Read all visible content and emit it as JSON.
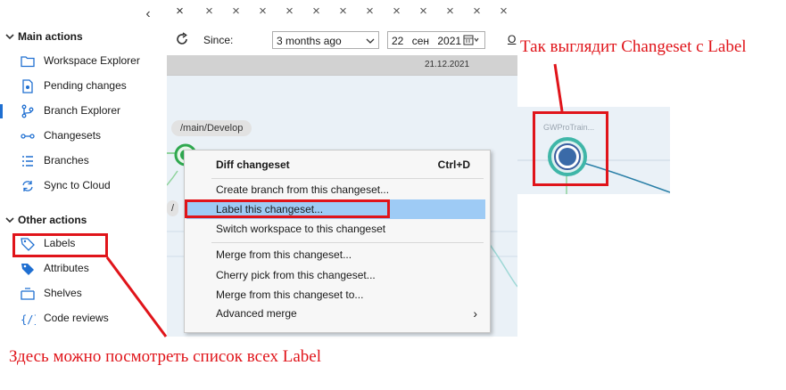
{
  "sidebar": {
    "collapse_glyph": "‹",
    "main_header": "Main actions",
    "main_items": [
      {
        "label": "Workspace Explorer",
        "icon": "folder-icon"
      },
      {
        "label": "Pending changes",
        "icon": "pending-changes-icon"
      },
      {
        "label": "Branch Explorer",
        "icon": "branch-explorer-icon"
      },
      {
        "label": "Changesets",
        "icon": "changesets-icon"
      },
      {
        "label": "Branches",
        "icon": "branches-list-icon"
      },
      {
        "label": "Sync to Cloud",
        "icon": "sync-icon"
      }
    ],
    "other_header": "Other actions",
    "other_items": [
      {
        "label": "Labels",
        "icon": "tag-icon"
      },
      {
        "label": "Attributes",
        "icon": "attributes-icon"
      },
      {
        "label": "Shelves",
        "icon": "shelves-icon"
      },
      {
        "label": "Code reviews",
        "icon": "code-review-icon"
      }
    ]
  },
  "tabs": {
    "close_glyph": "×",
    "count": 13
  },
  "toolbar": {
    "since_label": "Since:",
    "since_value": "3 months ago",
    "date_day": "22",
    "date_month": "сен",
    "date_year": "2021",
    "truncated_label": "O"
  },
  "graph": {
    "date_label": "21.12.2021",
    "branch_label": "/main/Develop",
    "branch_label_2": "/"
  },
  "context_menu": {
    "items": [
      {
        "label": "Diff changeset",
        "shortcut": "Ctrl+D",
        "bold": true
      },
      {
        "label": "Create branch from this changeset..."
      },
      {
        "label": "Label this changeset...",
        "highlighted": true
      },
      {
        "label": "Switch workspace to this changeset"
      },
      {
        "label": "Merge from this changeset..."
      },
      {
        "label": "Cherry pick from this changeset..."
      },
      {
        "label": "Merge from this changeset to..."
      },
      {
        "label": "Advanced merge",
        "submenu_glyph": "›"
      }
    ]
  },
  "preview": {
    "node_label": "GWProTrain..."
  },
  "annotations": {
    "top_right": "Так выглядит Changeset с Label",
    "bottom": "Здесь можно посмотреть список всех Label"
  },
  "colors": {
    "accent": "#1f6fd1",
    "annotation_red": "#e0141a",
    "menu_highlight": "#9ecbf5",
    "node_green": "#2fa84f",
    "node_teal": "#3fb6a8"
  }
}
